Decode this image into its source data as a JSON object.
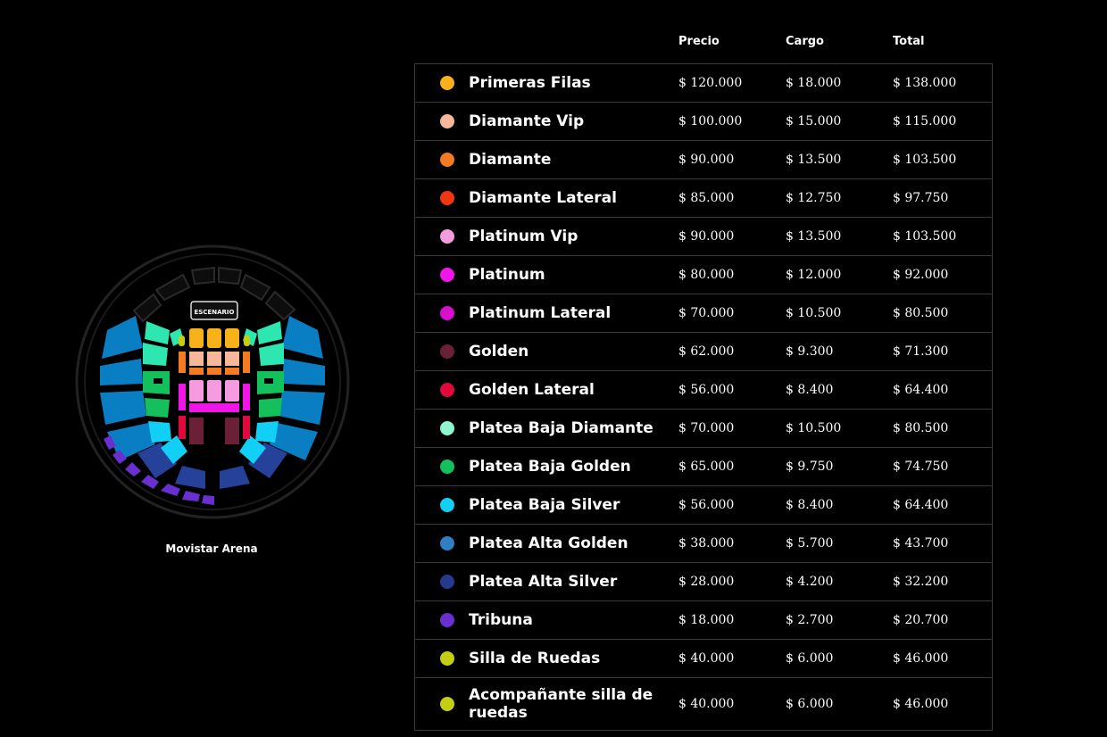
{
  "venue": {
    "name": "Movistar Arena",
    "stage_label": "ESCENARIO"
  },
  "table": {
    "headers": {
      "price": "Precio",
      "charge": "Cargo",
      "total": "Total"
    },
    "rows": [
      {
        "zone": "Primeras Filas",
        "color": "#f7b21a",
        "price": "$ 120.000",
        "charge": "$ 18.000",
        "total": "$ 138.000"
      },
      {
        "zone": "Diamante Vip",
        "color": "#f7b79a",
        "price": "$ 100.000",
        "charge": "$ 15.000",
        "total": "$ 115.000"
      },
      {
        "zone": "Diamante",
        "color": "#f47b20",
        "price": "$ 90.000",
        "charge": "$ 13.500",
        "total": "$ 103.500"
      },
      {
        "zone": "Diamante Lateral",
        "color": "#f2360f",
        "price": "$ 85.000",
        "charge": "$ 12.750",
        "total": "$ 97.750"
      },
      {
        "zone": "Platinum Vip",
        "color": "#f69be0",
        "price": "$ 90.000",
        "charge": "$ 13.500",
        "total": "$ 103.500"
      },
      {
        "zone": "Platinum",
        "color": "#f016e8",
        "price": "$ 80.000",
        "charge": "$ 12.000",
        "total": "$ 92.000"
      },
      {
        "zone": "Platinum Lateral",
        "color": "#d80fcd",
        "price": "$ 70.000",
        "charge": "$ 10.500",
        "total": "$ 80.500"
      },
      {
        "zone": "Golden",
        "color": "#6a2138",
        "price": "$ 62.000",
        "charge": "$ 9.300",
        "total": "$ 71.300"
      },
      {
        "zone": "Golden Lateral",
        "color": "#df0a3b",
        "price": "$ 56.000",
        "charge": "$ 8.400",
        "total": "$ 64.400"
      },
      {
        "zone": "Platea Baja Diamante",
        "color": "#8ff5cc",
        "price": "$ 70.000",
        "charge": "$ 10.500",
        "total": "$ 80.500"
      },
      {
        "zone": "Platea Baja Golden",
        "color": "#13c05c",
        "price": "$ 65.000",
        "charge": "$ 9.750",
        "total": "$ 74.750"
      },
      {
        "zone": "Platea Baja Silver",
        "color": "#12d0f5",
        "price": "$ 56.000",
        "charge": "$ 8.400",
        "total": "$ 64.400"
      },
      {
        "zone": "Platea Alta Golden",
        "color": "#2e7fc4",
        "price": "$ 38.000",
        "charge": "$ 5.700",
        "total": "$ 43.700"
      },
      {
        "zone": "Platea Alta Silver",
        "color": "#263a8c",
        "price": "$ 28.000",
        "charge": "$ 4.200",
        "total": "$ 32.200"
      },
      {
        "zone": "Tribuna",
        "color": "#6a2fd0",
        "price": "$ 18.000",
        "charge": "$ 2.700",
        "total": "$ 20.700"
      },
      {
        "zone": "Silla de Ruedas",
        "color": "#c5cf12",
        "price": "$ 40.000",
        "charge": "$ 6.000",
        "total": "$ 46.000"
      },
      {
        "zone": "Acompañante silla de ruedas",
        "color": "#c5cf12",
        "price": "$ 40.000",
        "charge": "$ 6.000",
        "total": "$ 46.000"
      }
    ]
  }
}
